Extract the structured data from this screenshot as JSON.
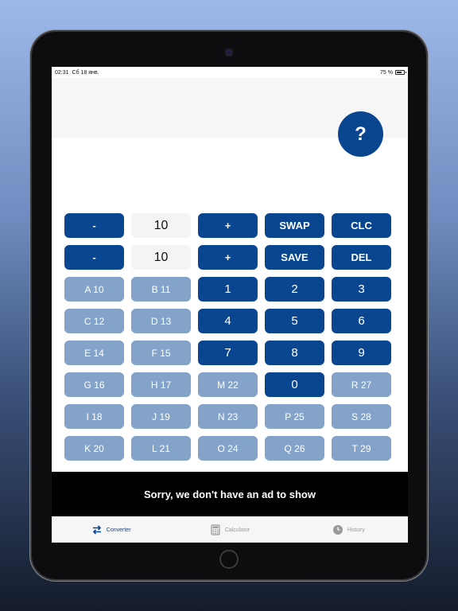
{
  "status": {
    "time": "02:31",
    "date": "Сб 18 янв.",
    "battery": "75 %",
    "battery_level": 0.75
  },
  "help": {
    "label": "?"
  },
  "rows": [
    [
      {
        "label": "-",
        "style": "dark"
      },
      {
        "label": "10",
        "style": "value"
      },
      {
        "label": "+",
        "style": "dark"
      },
      {
        "label": "SWAP",
        "style": "dark"
      },
      {
        "label": "CLC",
        "style": "dark"
      }
    ],
    [
      {
        "label": "-",
        "style": "dark"
      },
      {
        "label": "10",
        "style": "value"
      },
      {
        "label": "+",
        "style": "dark"
      },
      {
        "label": "SAVE",
        "style": "dark"
      },
      {
        "label": "DEL",
        "style": "dark"
      }
    ],
    [
      {
        "label": "A 10",
        "style": "light"
      },
      {
        "label": "B 11",
        "style": "light"
      },
      {
        "label": "1",
        "style": "dark num"
      },
      {
        "label": "2",
        "style": "dark num"
      },
      {
        "label": "3",
        "style": "dark num"
      }
    ],
    [
      {
        "label": "C 12",
        "style": "light"
      },
      {
        "label": "D 13",
        "style": "light"
      },
      {
        "label": "4",
        "style": "dark num"
      },
      {
        "label": "5",
        "style": "dark num"
      },
      {
        "label": "6",
        "style": "dark num"
      }
    ],
    [
      {
        "label": "E 14",
        "style": "light"
      },
      {
        "label": "F 15",
        "style": "light"
      },
      {
        "label": "7",
        "style": "dark num"
      },
      {
        "label": "8",
        "style": "dark num"
      },
      {
        "label": "9",
        "style": "dark num"
      }
    ],
    [
      {
        "label": "G 16",
        "style": "light"
      },
      {
        "label": "H 17",
        "style": "light"
      },
      {
        "label": "M 22",
        "style": "light"
      },
      {
        "label": "0",
        "style": "dark num"
      },
      {
        "label": "R 27",
        "style": "light"
      }
    ],
    [
      {
        "label": "I 18",
        "style": "light"
      },
      {
        "label": "J 19",
        "style": "light"
      },
      {
        "label": "N 23",
        "style": "light"
      },
      {
        "label": "P 25",
        "style": "light"
      },
      {
        "label": "S 28",
        "style": "light"
      }
    ],
    [
      {
        "label": "K 20",
        "style": "light"
      },
      {
        "label": "L 21",
        "style": "light"
      },
      {
        "label": "O 24",
        "style": "light"
      },
      {
        "label": "Q 26",
        "style": "light"
      },
      {
        "label": "T 29",
        "style": "light"
      }
    ]
  ],
  "ad": {
    "text": "Sorry, we don't have an ad to show"
  },
  "tabs": [
    {
      "label": "Converter",
      "icon": "swap-arrows-icon",
      "active": true
    },
    {
      "label": "Calculator",
      "icon": "calculator-icon",
      "active": false
    },
    {
      "label": "History",
      "icon": "clock-icon",
      "active": false
    }
  ],
  "colors": {
    "primary": "#0a4690",
    "secondary": "#83a3c9",
    "value_bg": "#f4f4f4"
  }
}
